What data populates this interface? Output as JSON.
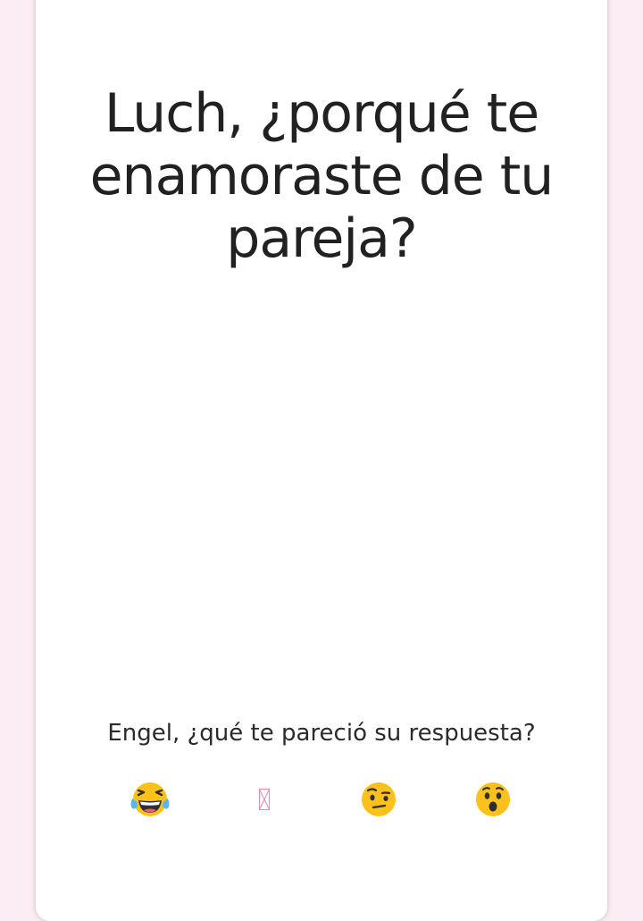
{
  "card": {
    "question": "Luch, ¿porqué te enamoraste de tu pareja?",
    "prompt": "Engel, ¿qué te pareció su respuesta?"
  },
  "reactions": [
    {
      "icon": "tears-of-joy-emoji"
    },
    {
      "icon": "missing-glyph-box"
    },
    {
      "icon": "raised-eyebrow-emoji"
    },
    {
      "icon": "astonished-emoji"
    }
  ],
  "colors": {
    "background": "#fcecf3",
    "card": "#ffffff",
    "text": "#212121",
    "emoji_yellow": "#fcc21b",
    "glyph_pink": "#e58aa9"
  }
}
